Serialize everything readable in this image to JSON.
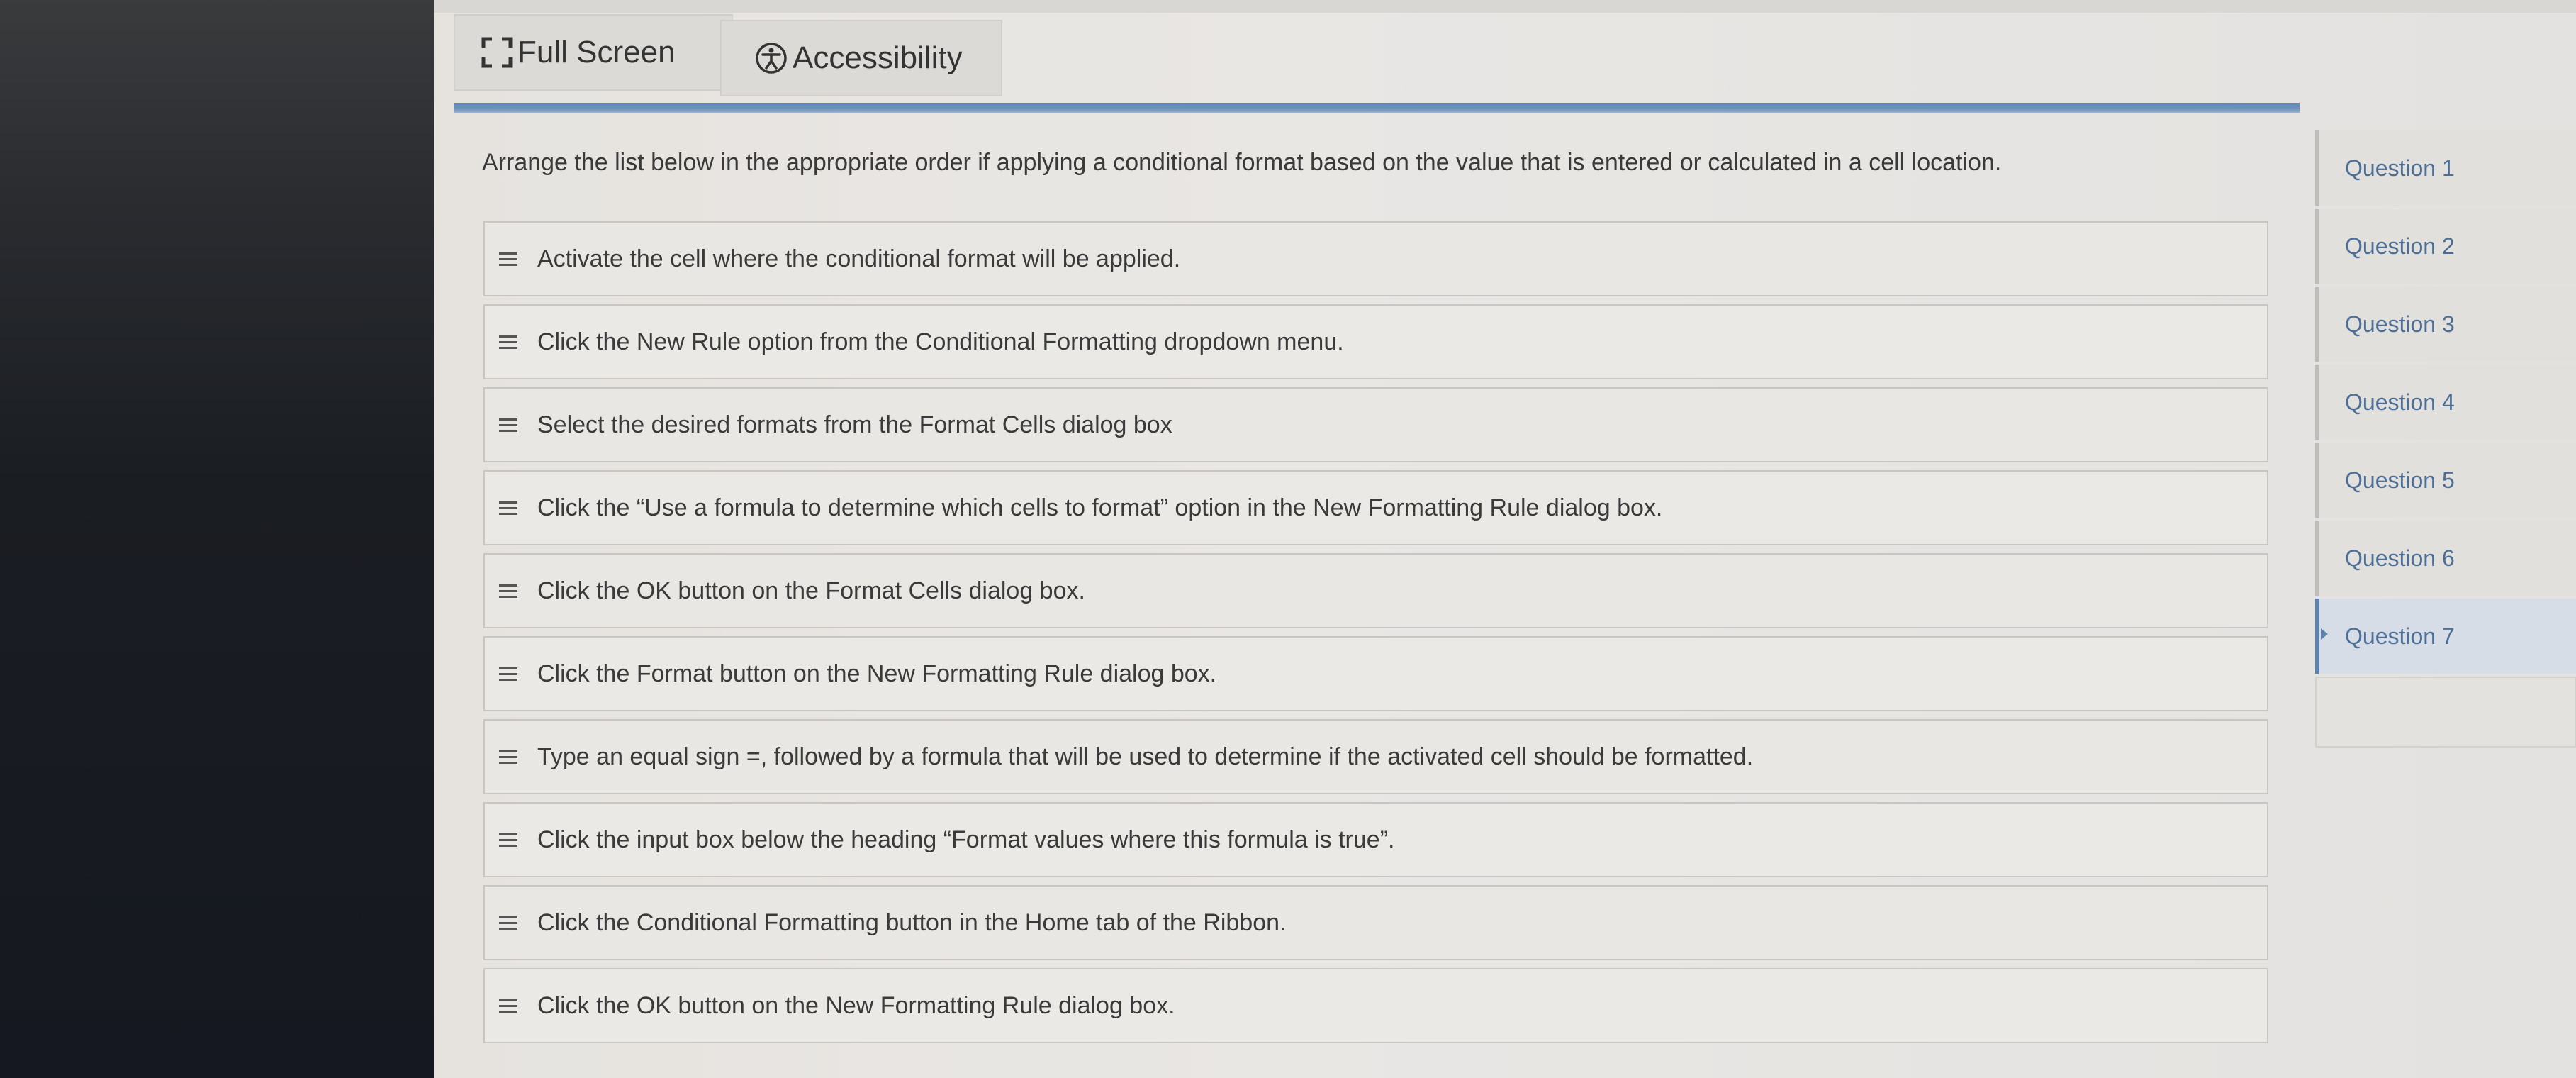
{
  "toolbar": {
    "fullscreen_label": "Full Screen",
    "accessibility_label": "Accessibility"
  },
  "question": {
    "prompt": "Arrange the list below in the appropriate order if applying a conditional format based on the value that is entered or calculated in a cell location."
  },
  "items": [
    {
      "label": "Activate the cell where the conditional format will be applied."
    },
    {
      "label": "Click the New Rule option from the Conditional Formatting dropdown menu."
    },
    {
      "label": "Select the desired formats from the Format Cells dialog box"
    },
    {
      "label": "Click the “Use a formula to determine which cells to format” option in the New Formatting Rule dialog box."
    },
    {
      "label": "Click the OK button on the Format Cells dialog box."
    },
    {
      "label": "Click the Format button on the New Formatting Rule dialog box."
    },
    {
      "label": "Type an equal sign =, followed by a formula that will be used to determine if the activated cell should be formatted."
    },
    {
      "label": "Click the input box below the heading “Format values where this formula is true”."
    },
    {
      "label": "Click the Conditional Formatting button in the Home tab of the Ribbon."
    },
    {
      "label": "Click the OK button on the New Formatting Rule dialog box."
    }
  ],
  "question_nav": [
    {
      "label": "Question 1"
    },
    {
      "label": "Question 2"
    },
    {
      "label": "Question 3"
    },
    {
      "label": "Question 4"
    },
    {
      "label": "Question 5"
    },
    {
      "label": "Question 6"
    },
    {
      "label": "Question 7",
      "active": true
    }
  ],
  "colors": {
    "accent_blue": "#5f87b3",
    "nav_text": "#4d6f96"
  },
  "icons": {
    "fullscreen": "fullscreen-icon",
    "accessibility": "accessibility-icon",
    "drag_handle": "drag-handle-icon"
  }
}
